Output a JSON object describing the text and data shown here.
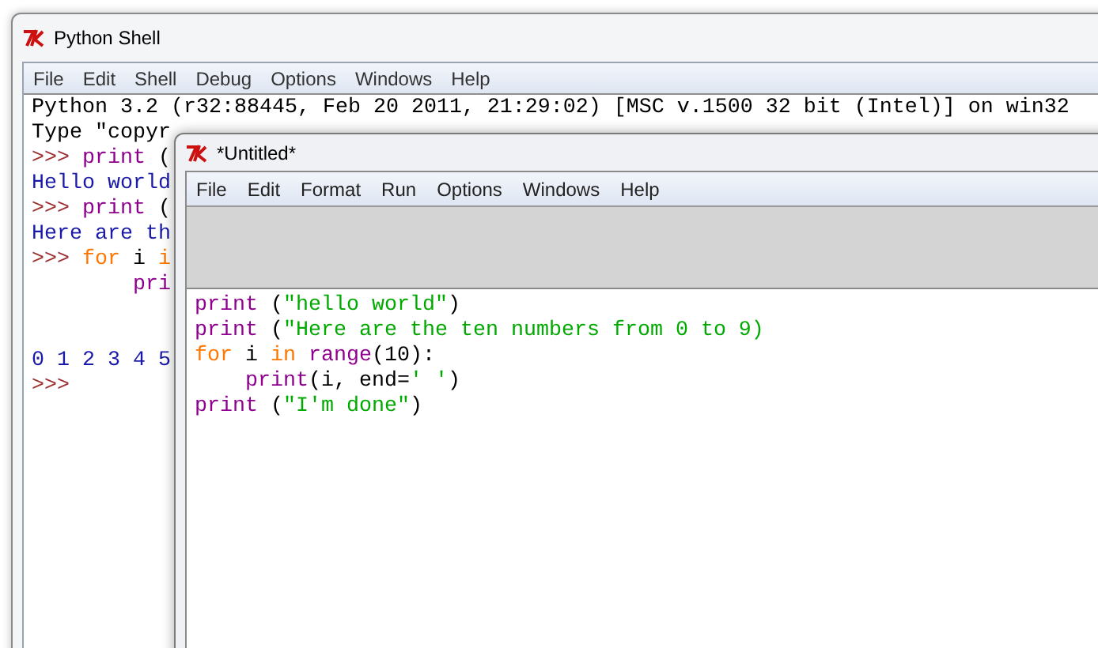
{
  "shell": {
    "title": "Python Shell",
    "menu": [
      "File",
      "Edit",
      "Shell",
      "Debug",
      "Options",
      "Windows",
      "Help"
    ],
    "lines": [
      {
        "segments": [
          {
            "kind": "plain",
            "text": "Python 3.2 (r32:88445, Feb 20 2011, 21:29:02) [MSC v.1500 32 bit (Intel)] on win32"
          }
        ]
      },
      {
        "segments": [
          {
            "kind": "plain",
            "text": "Type \"copyr"
          }
        ]
      },
      {
        "segments": [
          {
            "kind": "prompt",
            "text": ">>> "
          },
          {
            "kind": "builtin",
            "text": "print"
          },
          {
            "kind": "plain",
            "text": " ("
          }
        ]
      },
      {
        "segments": [
          {
            "kind": "output",
            "text": "Hello world"
          }
        ]
      },
      {
        "segments": [
          {
            "kind": "prompt",
            "text": ">>> "
          },
          {
            "kind": "builtin",
            "text": "print"
          },
          {
            "kind": "plain",
            "text": " ("
          }
        ]
      },
      {
        "segments": [
          {
            "kind": "output",
            "text": "Here are th"
          }
        ]
      },
      {
        "segments": [
          {
            "kind": "prompt",
            "text": ">>> "
          },
          {
            "kind": "keyword",
            "text": "for"
          },
          {
            "kind": "plain",
            "text": " i "
          },
          {
            "kind": "keyword",
            "text": "i"
          }
        ]
      },
      {
        "segments": [
          {
            "kind": "builtin",
            "text": "        pri"
          }
        ]
      }
    ],
    "output_lines": [
      {
        "segments": [
          {
            "kind": "output",
            "text": "0 1 2 3 4 5"
          }
        ]
      },
      {
        "segments": [
          {
            "kind": "prompt",
            "text": ">>>"
          }
        ]
      }
    ]
  },
  "editor": {
    "title": "*Untitled*",
    "menu": [
      "File",
      "Edit",
      "Format",
      "Run",
      "Options",
      "Windows",
      "Help"
    ],
    "lines": [
      {
        "segments": [
          {
            "kind": "builtin",
            "text": "print"
          },
          {
            "kind": "plain",
            "text": " ("
          },
          {
            "kind": "string",
            "text": "\"hello world\""
          },
          {
            "kind": "plain",
            "text": ")"
          }
        ]
      },
      {
        "segments": [
          {
            "kind": "builtin",
            "text": "print"
          },
          {
            "kind": "plain",
            "text": " ("
          },
          {
            "kind": "string",
            "text": "\"Here are the ten numbers from 0 to 9)"
          }
        ]
      },
      {
        "segments": [
          {
            "kind": "keyword",
            "text": "for"
          },
          {
            "kind": "plain",
            "text": " i "
          },
          {
            "kind": "keyword",
            "text": "in"
          },
          {
            "kind": "builtin",
            "text": " range"
          },
          {
            "kind": "plain",
            "text": "(10):"
          }
        ]
      },
      {
        "segments": [
          {
            "kind": "builtin",
            "text": "    print"
          },
          {
            "kind": "plain",
            "text": "(i, end="
          },
          {
            "kind": "string",
            "text": "' '"
          },
          {
            "kind": "plain",
            "text": ")"
          }
        ]
      },
      {
        "segments": [
          {
            "kind": "builtin",
            "text": "print"
          },
          {
            "kind": "plain",
            "text": " ("
          },
          {
            "kind": "string",
            "text": "\"I'm done\""
          },
          {
            "kind": "plain",
            "text": ")"
          }
        ]
      }
    ]
  }
}
